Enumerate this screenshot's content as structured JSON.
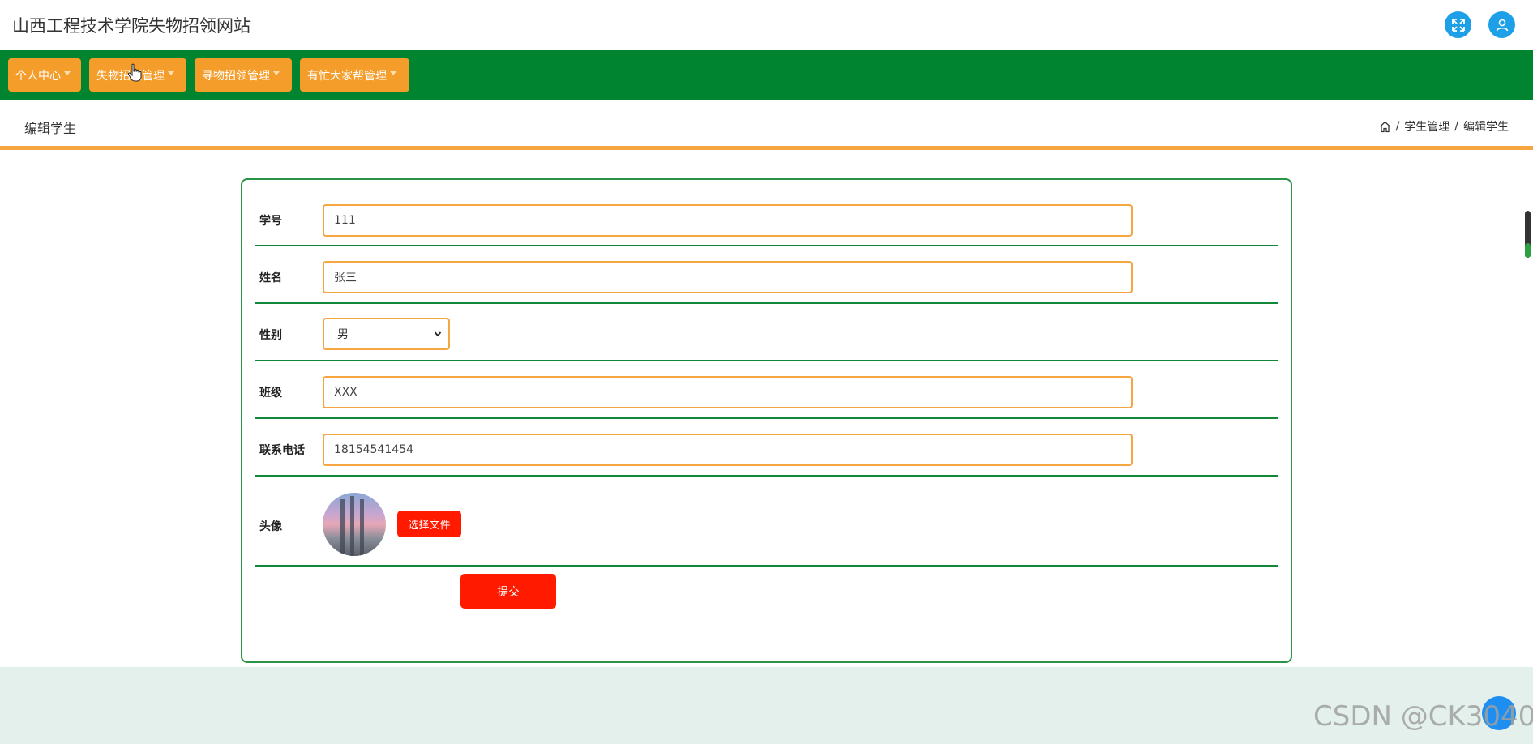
{
  "app": {
    "title": "山西工程技术学院失物招领网站",
    "accent": "#00842f",
    "nav_button_color": "#f59d2a",
    "danger_button_color": "#ff1a00"
  },
  "header": {
    "icons": [
      "fullscreen-icon",
      "user-icon"
    ]
  },
  "nav": {
    "items": [
      {
        "label": "个人中心"
      },
      {
        "label": "失物招领管理"
      },
      {
        "label": "寻物招领管理"
      },
      {
        "label": "有忙大家帮管理"
      }
    ]
  },
  "page": {
    "title": "编辑学生",
    "breadcrumb": [
      "学生管理",
      "编辑学生"
    ]
  },
  "form": {
    "student_id": {
      "label": "学号",
      "value": "111"
    },
    "name": {
      "label": "姓名",
      "value": "张三"
    },
    "gender": {
      "label": "性别",
      "value": "男"
    },
    "class": {
      "label": "班级",
      "value": "XXX"
    },
    "phone": {
      "label": "联系电话",
      "value": "18154541454"
    },
    "avatar": {
      "label": "头像",
      "button": "选择文件"
    },
    "submit": "提交"
  },
  "watermark": "CSDN @CK3040"
}
